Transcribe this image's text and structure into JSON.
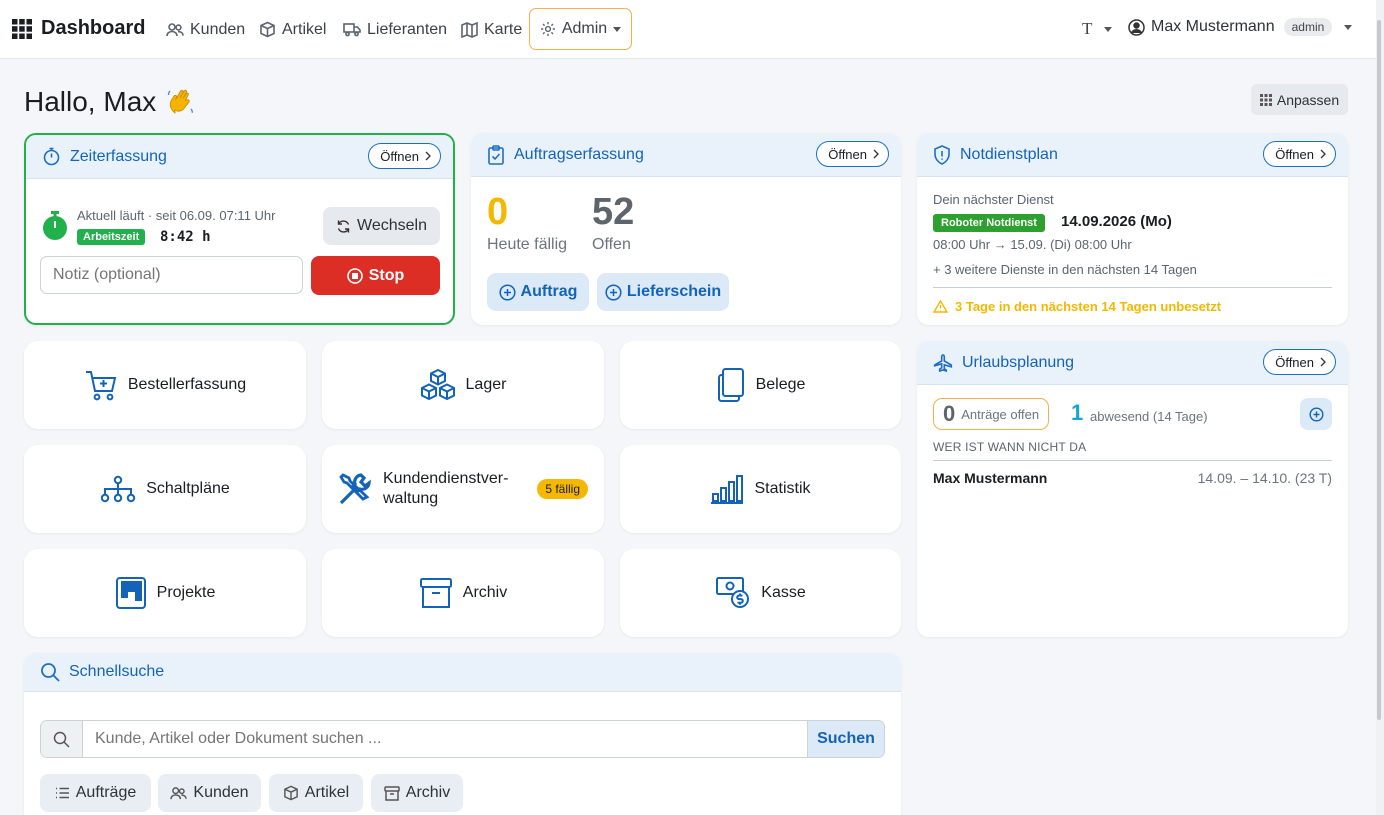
{
  "nav": {
    "brand": "Dashboard",
    "links": [
      {
        "label": "Kunden",
        "icon": "users-icon"
      },
      {
        "label": "Artikel",
        "icon": "box-icon"
      },
      {
        "label": "Lieferanten",
        "icon": "truck-icon"
      },
      {
        "label": "Karte",
        "icon": "map-icon"
      }
    ],
    "admin": "Admin",
    "text_tool": "T",
    "user": "Max Mustermann",
    "role": "admin"
  },
  "greeting": "Hallo, Max",
  "customize": "Anpassen",
  "zeit": {
    "title": "Zeiterfassung",
    "open": "Öffnen",
    "running": "Aktuell läuft · seit 06.09. 07:11 Uhr",
    "badge": "Arbeitszeit",
    "duration": "8:42 h",
    "switch": "Wechseln",
    "note_placeholder": "Notiz (optional)",
    "stop": "Stop"
  },
  "auftrag": {
    "title": "Auftragserfassung",
    "open": "Öffnen",
    "due_count": "0",
    "due_label": "Heute fällig",
    "open_count": "52",
    "open_label": "Offen",
    "btn_order": "Auftrag",
    "btn_delivery": "Lieferschein"
  },
  "notdienst": {
    "title": "Notdienstplan",
    "open": "Öffnen",
    "next": "Dein nächster Dienst",
    "badge": "Roboter Notdienst",
    "date": "14.09.2026 (Mo)",
    "range": "08:00 Uhr → 15.09. (Di) 08:00 Uhr",
    "more": "+ 3 weitere Dienste in den nächsten 14 Tagen",
    "warning": "3 Tage in den nächsten 14 Tagen unbesetzt"
  },
  "urlaub": {
    "title": "Urlaubsplanung",
    "open": "Öffnen",
    "requests_count": "0",
    "requests_label": "Anträge offen",
    "absent_count": "1",
    "absent_label": "abwesend (14 Tage)",
    "section": "WER IST WANN NICHT DA",
    "rows": [
      {
        "name": "Max Mustermann",
        "range": "14.09. – 14.10. (23 T)"
      }
    ]
  },
  "tiles": {
    "bestell": "Bestellerfassung",
    "lager": "Lager",
    "belege": "Belege",
    "schalt": "Schaltpläne",
    "kunden_l1": "Kundendienstver-",
    "kunden_l2": "waltung",
    "kunden_badge": "5 fällig",
    "statistik": "Statistik",
    "projekte": "Projekte",
    "archiv": "Archiv",
    "kasse": "Kasse"
  },
  "search": {
    "title": "Schnellsuche",
    "placeholder": "Kunde, Artikel oder Dokument suchen ...",
    "button": "Suchen",
    "filters": [
      "Aufträge",
      "Kunden",
      "Artikel",
      "Archiv"
    ]
  },
  "colors": {
    "accent": "#1364b8",
    "green": "#22b04c",
    "red": "#dc2e25",
    "amber": "#f5b800"
  }
}
